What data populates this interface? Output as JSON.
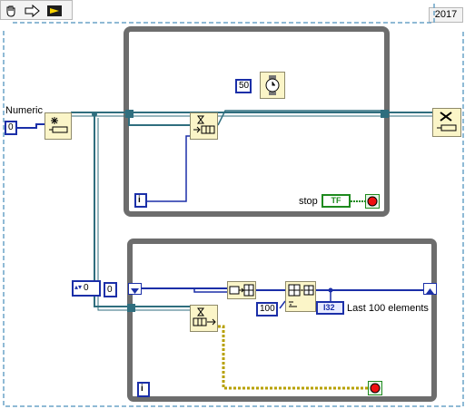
{
  "toolbar": {
    "tools": [
      {
        "name": "operate-tool"
      },
      {
        "name": "run-arrow"
      },
      {
        "name": "labview-logo"
      }
    ],
    "version": "2017"
  },
  "block_diagram": {
    "numeric_label": "Numeric",
    "numeric_value": "0",
    "wait_constant": "50",
    "stop_label": "stop",
    "stop_bool": "TF",
    "loop1_iter": "i",
    "loop2_iter": "i",
    "index_display": "0",
    "index_display2": "0",
    "array_size_constant": "100",
    "indicator_type": "I32",
    "indicator_label": "Last 100 elements"
  },
  "colors": {
    "loop_border": "#6d6d6d",
    "blue_wire": "#1b2fa8",
    "queue_wire": "#2f6e7e",
    "error_wire": "#b7a000",
    "node_fill": "#fbf5c8",
    "stop_green": "#1e8a1e"
  }
}
